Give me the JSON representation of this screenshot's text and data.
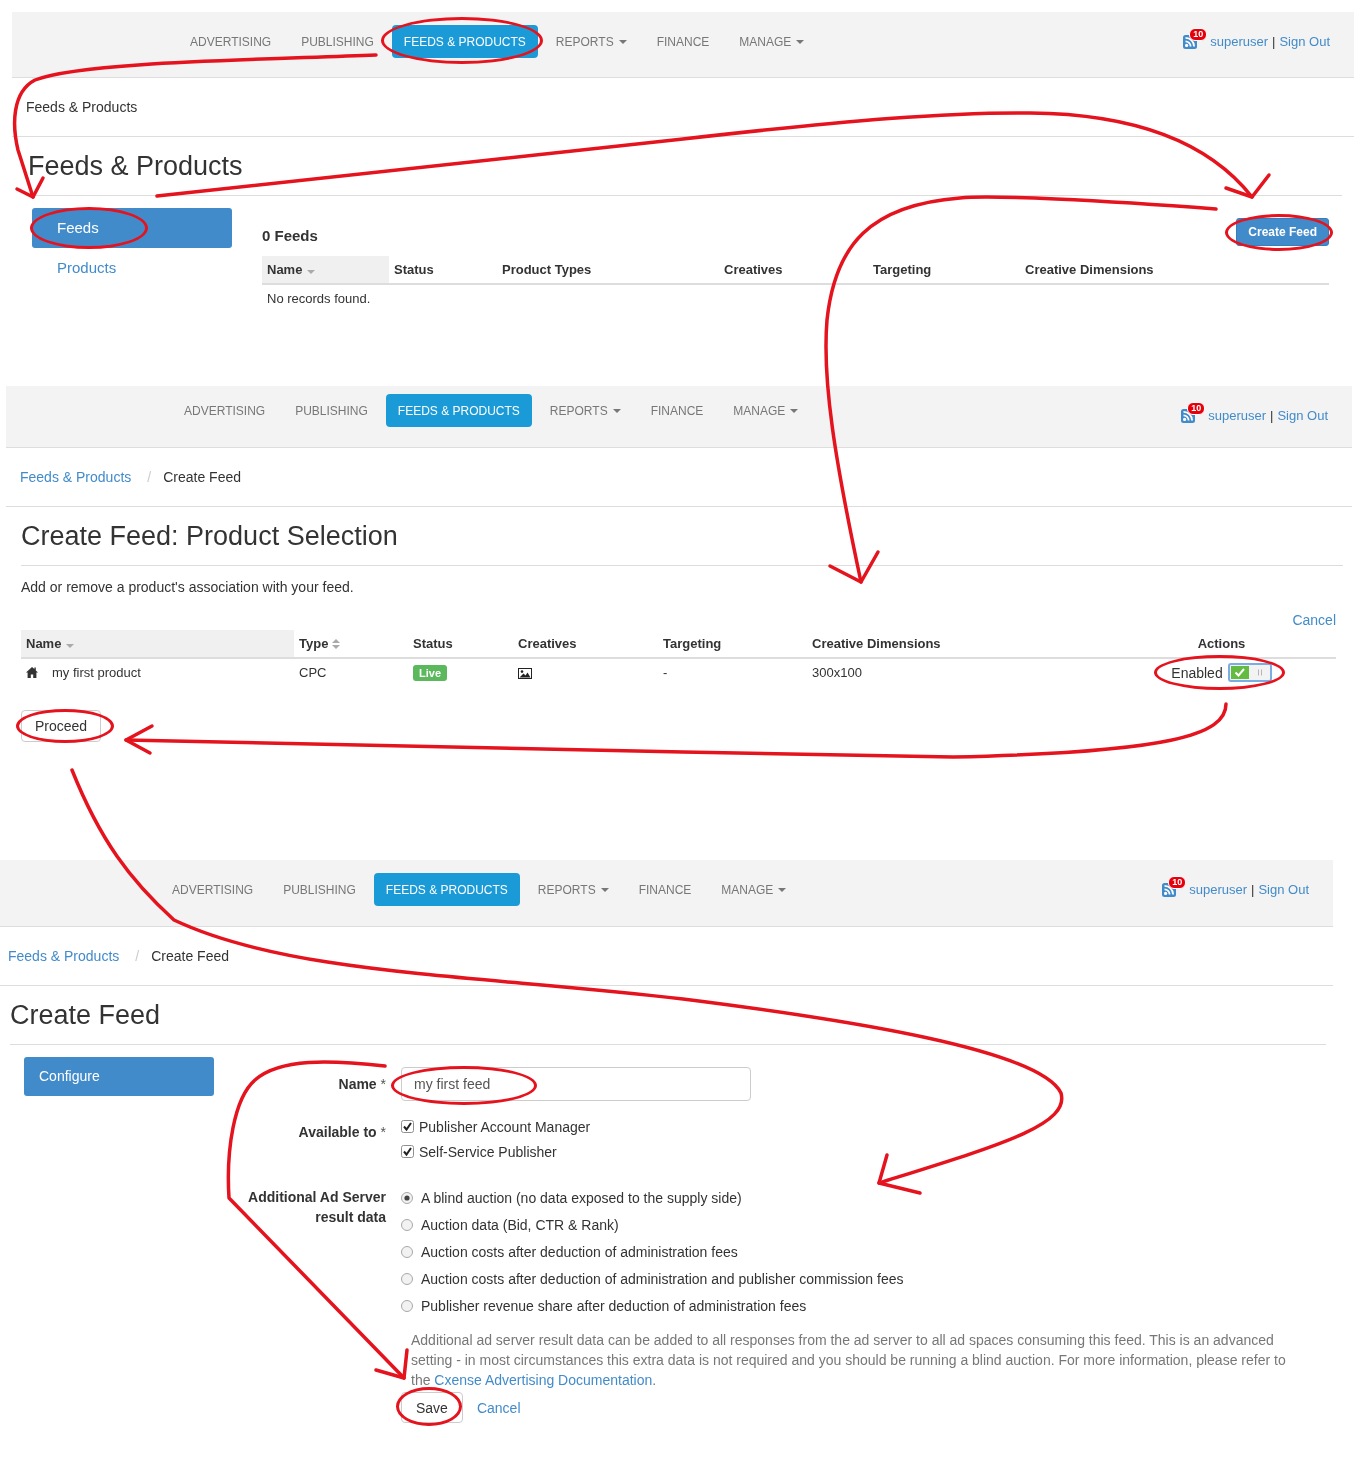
{
  "screens": [
    {
      "kind": "feed_list",
      "nav": {
        "items": [
          {
            "label": "ADVERTISING",
            "selected": false,
            "dropdown": false,
            "circled": false
          },
          {
            "label": "PUBLISHING",
            "selected": false,
            "dropdown": false,
            "circled": false
          },
          {
            "label": "FEEDS & PRODUCTS",
            "selected": true,
            "dropdown": false,
            "circled": true
          },
          {
            "label": "REPORTS",
            "selected": false,
            "dropdown": true,
            "circled": false
          },
          {
            "label": "FINANCE",
            "selected": false,
            "dropdown": false,
            "circled": false
          },
          {
            "label": "MANAGE",
            "selected": false,
            "dropdown": true,
            "circled": false
          }
        ],
        "notification_count": "10",
        "username": "superuser",
        "separator": "|",
        "sign_out": "Sign Out"
      },
      "breadcrumb": [
        {
          "label": "Feeds & Products",
          "current": true
        }
      ],
      "title": "Feeds & Products",
      "sidebar": [
        {
          "label": "Feeds",
          "selected": true,
          "circled": true
        },
        {
          "label": "Products",
          "selected": false,
          "circled": false
        }
      ],
      "count": "0 Feeds",
      "create_button": {
        "label": "Create Feed",
        "circled": true
      },
      "table": {
        "columns": [
          {
            "label": "Name",
            "sorted": true,
            "sortable": true
          },
          {
            "label": "Status",
            "sorted": false,
            "sortable": false
          },
          {
            "label": "Product Types",
            "sorted": false,
            "sortable": false
          },
          {
            "label": "Creatives",
            "sorted": false,
            "sortable": false
          },
          {
            "label": "Targeting",
            "sorted": false,
            "sortable": false
          },
          {
            "label": "Creative Dimensions",
            "sorted": false,
            "sortable": false
          }
        ],
        "empty_message": "No records found."
      }
    },
    {
      "kind": "product_selection",
      "nav": {
        "items": [
          {
            "label": "ADVERTISING",
            "selected": false,
            "dropdown": false,
            "circled": false
          },
          {
            "label": "PUBLISHING",
            "selected": false,
            "dropdown": false,
            "circled": false
          },
          {
            "label": "FEEDS & PRODUCTS",
            "selected": true,
            "dropdown": false,
            "circled": false
          },
          {
            "label": "REPORTS",
            "selected": false,
            "dropdown": true,
            "circled": false
          },
          {
            "label": "FINANCE",
            "selected": false,
            "dropdown": false,
            "circled": false
          },
          {
            "label": "MANAGE",
            "selected": false,
            "dropdown": true,
            "circled": false
          }
        ],
        "notification_count": "10",
        "username": "superuser",
        "separator": "|",
        "sign_out": "Sign Out"
      },
      "breadcrumb": [
        {
          "label": "Feeds & Products",
          "current": false
        },
        {
          "label": "Create Feed",
          "current": true
        }
      ],
      "breadcrumb_separator": "/",
      "title": "Create Feed: Product Selection",
      "description": "Add or remove a product's association with your feed.",
      "cancel": "Cancel",
      "table": {
        "columns": [
          {
            "label": "Name",
            "sorted": true,
            "sortable": true
          },
          {
            "label": "Type",
            "sorted": false,
            "sortable": true
          },
          {
            "label": "Status",
            "sorted": false,
            "sortable": false
          },
          {
            "label": "Creatives",
            "sorted": false,
            "sortable": false
          },
          {
            "label": "Targeting",
            "sorted": false,
            "sortable": false
          },
          {
            "label": "Creative Dimensions",
            "sorted": false,
            "sortable": false
          },
          {
            "label": "Actions",
            "sorted": false,
            "sortable": false
          }
        ],
        "rows": [
          {
            "name": "my first product",
            "type": "CPC",
            "status": "Live",
            "targeting": "-",
            "dimensions": "300x100",
            "action_label": "Enabled",
            "enabled": true,
            "circled": true
          }
        ]
      },
      "proceed": {
        "label": "Proceed",
        "circled": true
      }
    },
    {
      "kind": "create_feed",
      "nav": {
        "items": [
          {
            "label": "ADVERTISING",
            "selected": false,
            "dropdown": false,
            "circled": false
          },
          {
            "label": "PUBLISHING",
            "selected": false,
            "dropdown": false,
            "circled": false
          },
          {
            "label": "FEEDS & PRODUCTS",
            "selected": true,
            "dropdown": false,
            "circled": false
          },
          {
            "label": "REPORTS",
            "selected": false,
            "dropdown": true,
            "circled": false
          },
          {
            "label": "FINANCE",
            "selected": false,
            "dropdown": false,
            "circled": false
          },
          {
            "label": "MANAGE",
            "selected": false,
            "dropdown": true,
            "circled": false
          }
        ],
        "notification_count": "10",
        "username": "superuser",
        "separator": "|",
        "sign_out": "Sign Out"
      },
      "breadcrumb": [
        {
          "label": "Feeds & Products",
          "current": false
        },
        {
          "label": "Create Feed",
          "current": true
        }
      ],
      "breadcrumb_separator": "/",
      "title": "Create Feed",
      "sidebar": [
        {
          "label": "Configure",
          "selected": true,
          "circled": false
        }
      ],
      "form": {
        "name": {
          "label": "Name",
          "required_mark": "*",
          "value": "my first feed",
          "circled": true
        },
        "available_to": {
          "label": "Available to",
          "required_mark": "*",
          "options": [
            {
              "label": "Publisher Account Manager",
              "checked": true
            },
            {
              "label": "Self-Service Publisher",
              "checked": true
            }
          ]
        },
        "result_data": {
          "label": "Additional Ad Server result data",
          "options": [
            {
              "label": "A blind auction (no data exposed to the supply side)",
              "selected": true
            },
            {
              "label": "Auction data (Bid, CTR & Rank)",
              "selected": false
            },
            {
              "label": "Auction costs after deduction of administration fees",
              "selected": false
            },
            {
              "label": "Auction costs after deduction of administration and publisher commission fees",
              "selected": false
            },
            {
              "label": "Publisher revenue share after deduction of administration fees",
              "selected": false
            }
          ]
        },
        "help": {
          "text": "Additional ad server result data can be added to all responses from the ad server to all ad spaces consuming this feed. This is an advanced setting - in most circumstances this extra data is not required and you should be running a blind auction. For more information, please refer to the",
          "link": "Cxense Advertising Documentation",
          "after": "."
        },
        "save": {
          "label": "Save",
          "circled": true
        },
        "cancel": "Cancel"
      }
    }
  ]
}
